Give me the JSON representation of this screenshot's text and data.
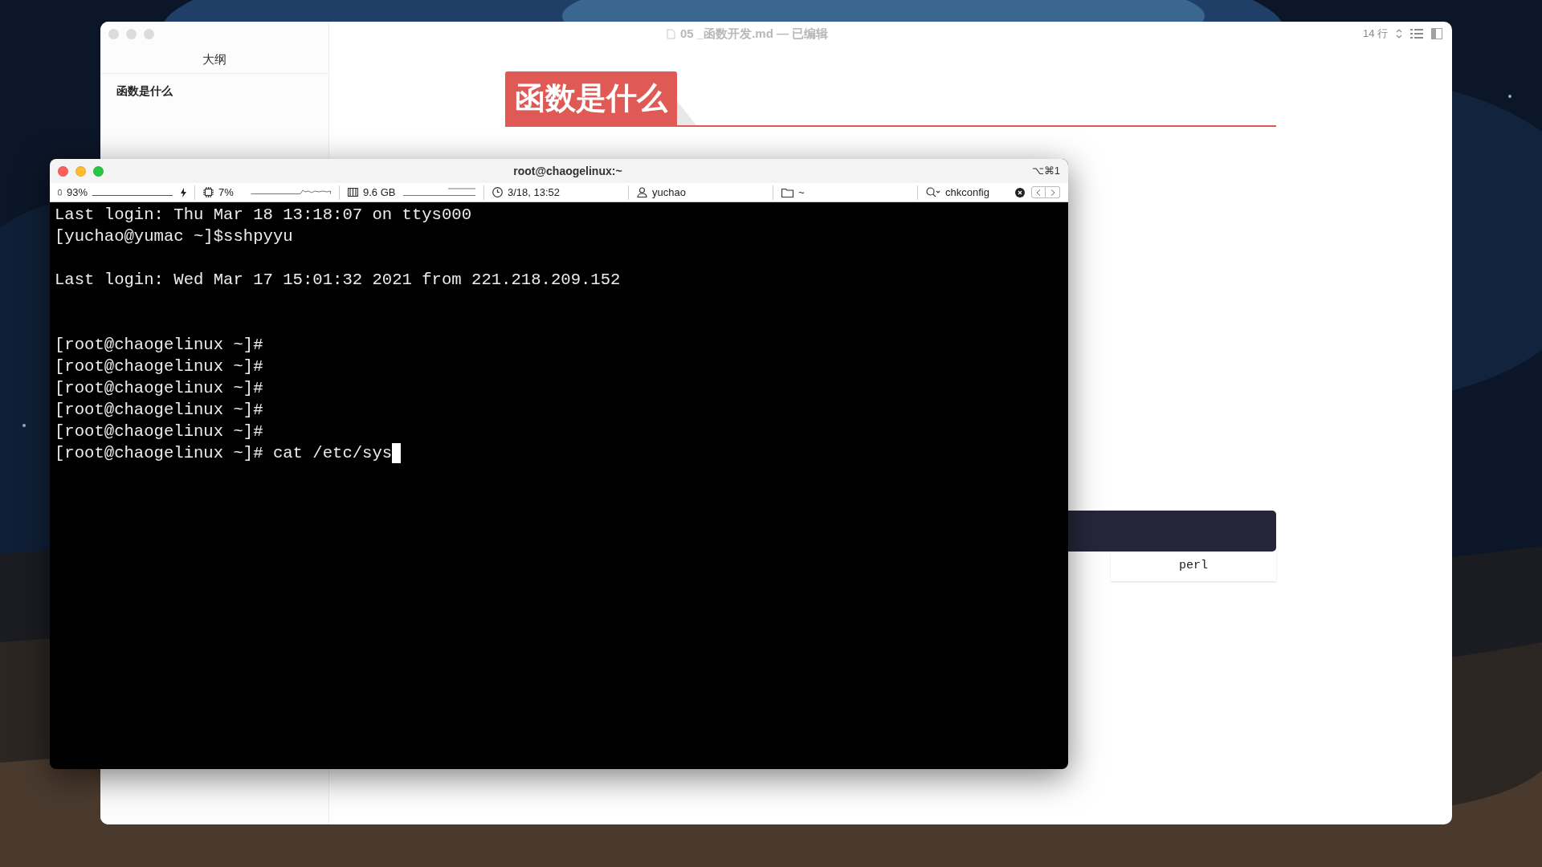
{
  "editor": {
    "active": false,
    "title": "05 _函数开发.md — 已编辑",
    "line_count": "14 行",
    "outline": {
      "heading": "大纲",
      "items": [
        {
          "label": "函数是什么"
        }
      ]
    },
    "document": {
      "heading": "函数是什么",
      "code_block": {
        "language": "perl"
      }
    }
  },
  "terminal": {
    "active": true,
    "title": "root@chaogelinux:~",
    "shortcut": "⌥⌘1",
    "status_bar": [
      {
        "kind": "battery",
        "text": "93%"
      },
      {
        "kind": "cpu",
        "text": "7%"
      },
      {
        "kind": "memory",
        "text": "9.6 GB"
      },
      {
        "kind": "clock",
        "text": "3/18, 13:52"
      },
      {
        "kind": "user",
        "text": "yuchao"
      },
      {
        "kind": "folder",
        "text": "~"
      },
      {
        "kind": "search",
        "text": "chkconfig"
      }
    ],
    "blocks": [
      {
        "kind": "output",
        "lines": [
          {
            "text": "Last login: Thu Mar 18 13:18:07 on ttys000",
            "cursor": false
          },
          {
            "text": "[yuchao@yumac ~]$sshpyyu",
            "cursor": false
          }
        ]
      },
      {
        "kind": "motd",
        "lines": [
          {
            "text": "Last login: Wed Mar 17 15:01:32 2021 from 221.218.209.152",
            "cursor": false
          }
        ]
      },
      {
        "kind": "output",
        "lines": [
          {
            "text": "[root@chaogelinux ~]#",
            "cursor": false
          },
          {
            "text": "[root@chaogelinux ~]#",
            "cursor": false
          },
          {
            "text": "[root@chaogelinux ~]#",
            "cursor": false
          },
          {
            "text": "[root@chaogelinux ~]#",
            "cursor": false
          },
          {
            "text": "[root@chaogelinux ~]#",
            "cursor": false
          },
          {
            "text": "[root@chaogelinux ~]# cat /etc/sys",
            "cursor": true
          }
        ]
      }
    ]
  }
}
